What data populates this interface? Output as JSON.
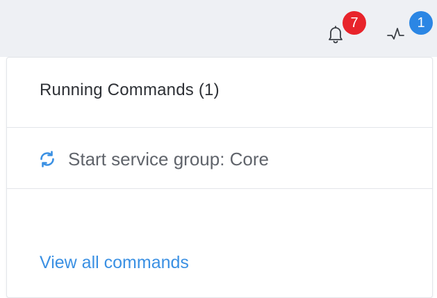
{
  "header": {
    "notifications": {
      "icon": "bell-icon",
      "count": "7",
      "badge_color": "#e8242b"
    },
    "operations": {
      "icon": "activity-pulse-icon",
      "count": "1",
      "badge_color": "#2b86e4"
    }
  },
  "panel": {
    "title": "Running Commands (1)",
    "commands": [
      {
        "icon": "refresh-spinner-icon",
        "label": "Start service group: Core"
      }
    ],
    "footer_link": "View all commands"
  },
  "colors": {
    "topbar_bg": "#eef0f4",
    "link": "#3a90e3",
    "spinner": "#3a90e3"
  }
}
